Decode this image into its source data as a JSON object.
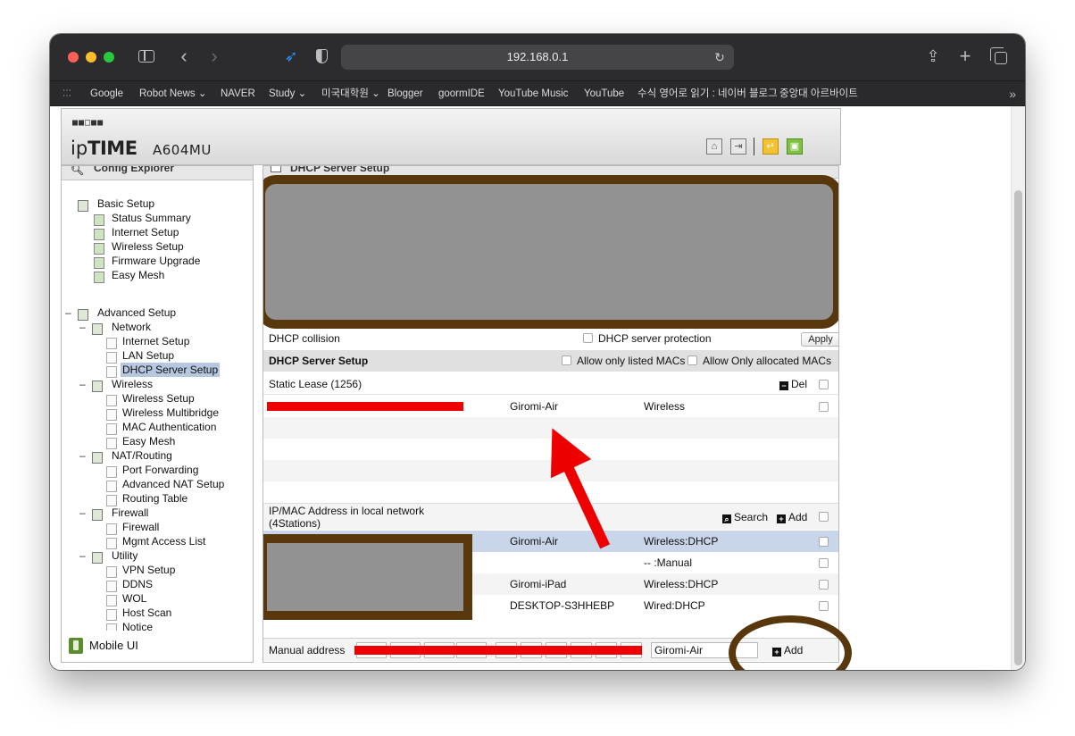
{
  "browser": {
    "url": "192.168.0.1",
    "bookmarks": [
      "Google",
      "Robot News ⌄",
      "NAVER",
      "Study ⌄",
      "미국대학원 ⌄",
      "Blogger",
      "goormIDE",
      "YouTube Music",
      "YouTube",
      "수식 영어로 읽기 : 네이버 블로그",
      "중앙대 아르바이트"
    ]
  },
  "router": {
    "brand_thin": "ip",
    "brand_bold": "TIME",
    "model": "A604MU"
  },
  "tree": {
    "title": "Config Explorer",
    "basic_setup": "Basic Setup",
    "basic_items": [
      "Status Summary",
      "Internet Setup",
      "Wireless Setup",
      "Firmware Upgrade",
      "Easy Mesh"
    ],
    "advanced_setup": "Advanced Setup",
    "network": "Network",
    "network_items": [
      "Internet Setup",
      "LAN Setup",
      "DHCP Server Setup"
    ],
    "wireless": "Wireless",
    "wireless_items": [
      "Wireless Setup",
      "Wireless Multibridge",
      "MAC Authentication",
      "Easy Mesh"
    ],
    "nat": "NAT/Routing",
    "nat_items": [
      "Port Forwarding",
      "Advanced NAT Setup",
      "Routing Table"
    ],
    "firewall": "Firewall",
    "firewall_items": [
      "Firewall",
      "Mgmt Access List"
    ],
    "utility": "Utility",
    "utility_items": [
      "VPN Setup",
      "DDNS",
      "WOL",
      "Host Scan",
      "Notice"
    ],
    "mobile_ui": "Mobile UI"
  },
  "main": {
    "title": "DHCP Server Setup",
    "dhcp_collision": "DHCP collision",
    "dhcp_server_protection": "DHCP server protection",
    "apply": "Apply",
    "section_title": "DHCP Server Setup",
    "allow_listed": "Allow only listed MACs",
    "allow_allocated": "Allow Only allocated MACs",
    "static_lease": "Static Lease (1256)",
    "del": "Del",
    "static_rows": [
      {
        "name": "Giromi-Air",
        "type": "Wireless"
      }
    ],
    "local_title_1": "IP/MAC Address in local network",
    "local_title_2": "(4Stations)",
    "search": "Search",
    "add": "Add",
    "local_rows": [
      {
        "name": "Giromi-Air",
        "type": "Wireless:DHCP"
      },
      {
        "name": "",
        "type": "-- :Manual"
      },
      {
        "name": "Giromi-iPad",
        "type": "Wireless:DHCP"
      },
      {
        "name": "DESKTOP-S3HHEBP",
        "type": "Wired:DHCP"
      }
    ],
    "manual_address": "Manual address",
    "manual_name_value": "Giromi-Air",
    "manual_add": "Add"
  }
}
